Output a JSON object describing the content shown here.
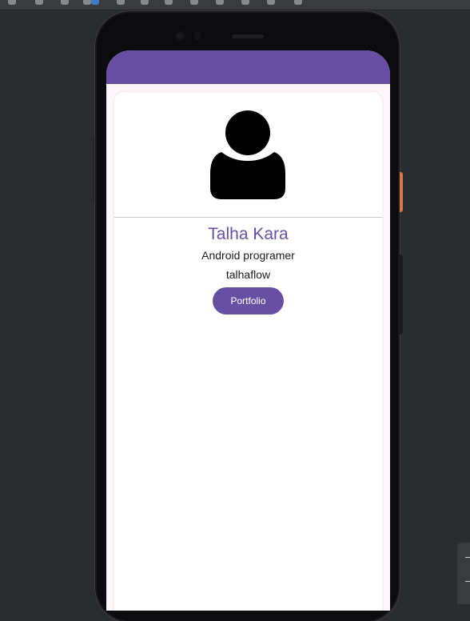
{
  "profile": {
    "name": "Talha Kara",
    "role": "Android programer",
    "handle": "talhaflow"
  },
  "actions": {
    "portfolio_label": "Portfolio"
  },
  "icons": {
    "avatar": "person-silhouette-icon"
  },
  "colors": {
    "primary": "#6750a4",
    "surface": "#fdf7fb",
    "card": "#ffffff",
    "ide_background": "#2b2c2e",
    "side_button_accent": "#d9754a"
  }
}
